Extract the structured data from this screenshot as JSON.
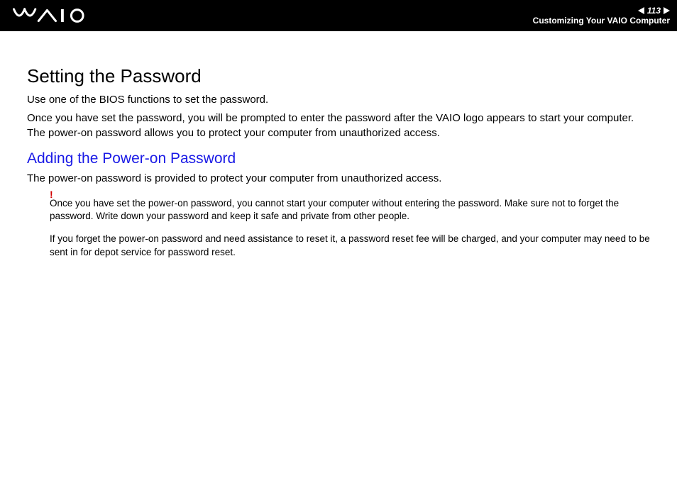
{
  "header": {
    "page_number": "113",
    "breadcrumb": "Customizing Your VAIO Computer"
  },
  "content": {
    "title": "Setting the Password",
    "intro1": "Use one of the BIOS functions to set the password.",
    "intro2": "Once you have set the password, you will be prompted to enter the password after the VAIO logo appears to start your computer. The power-on password allows you to protect your computer from unauthorized access.",
    "section1": {
      "title": "Adding the Power-on Password",
      "intro": "The power-on password is provided to protect your computer from unauthorized access.",
      "warning_mark": "!",
      "warning": "Once you have set the power-on password, you cannot start your computer without entering the password. Make sure not to forget the password. Write down your password and keep it safe and private from other people.",
      "note": "If you forget the power-on password and need assistance to reset it, a password reset fee will be charged, and your computer may need to be sent in for depot service for password reset."
    }
  }
}
